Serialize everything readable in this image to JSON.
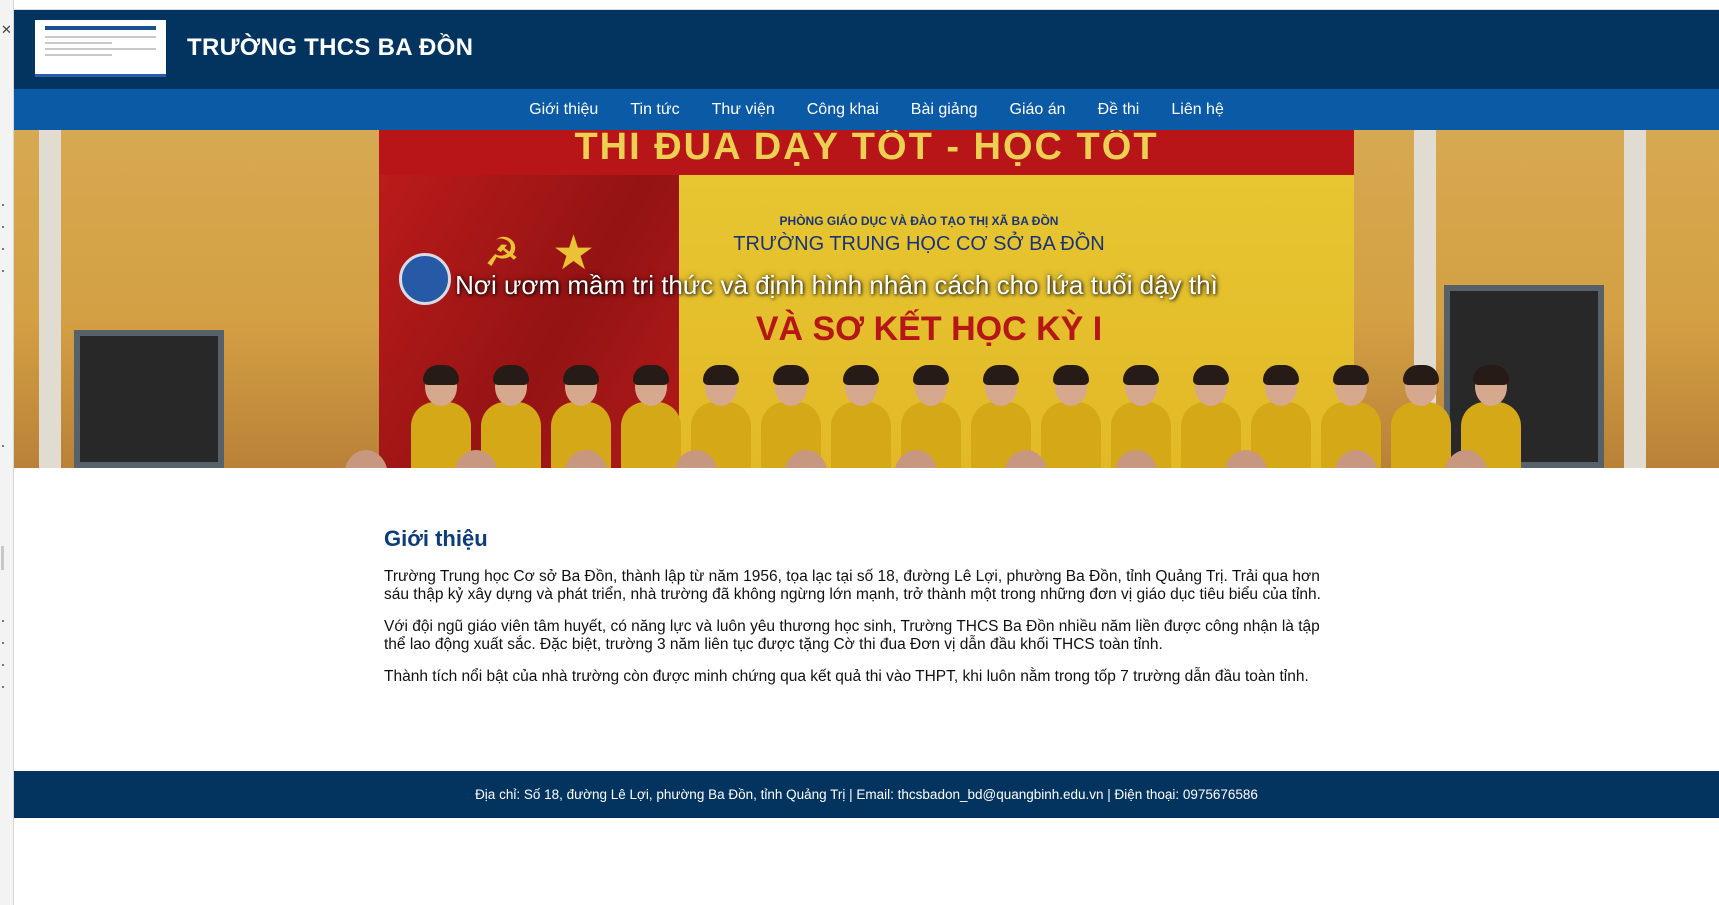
{
  "header": {
    "site_title": "TRƯỜNG THCS BA ĐỒN"
  },
  "nav": {
    "items": [
      "Giới thiệu",
      "Tin tức",
      "Thư viện",
      "Công khai",
      "Bài giảng",
      "Giáo án",
      "Đề thi",
      "Liên hệ"
    ]
  },
  "hero": {
    "caption": "Nơi ươm mầm tri thức và định hình nhân cách cho lứa tuổi dậy thì",
    "banner_top_text": "THI ĐUA DẠY TỐT - HỌC TỐT",
    "banner_small_text": "PHÒNG GIÁO DỤC VÀ ĐÀO TẠO THỊ XÃ BA ĐỒN",
    "banner_school_text": "TRƯỜNG TRUNG HỌC CƠ SỞ BA ĐỒN",
    "banner_big_text": "VÀ SƠ KẾT HỌC KỲ I"
  },
  "main": {
    "title": "Giới thiệu",
    "paragraphs": [
      "Trường Trung học Cơ sở Ba Đồn, thành lập từ năm 1956, tọa lạc tại số 18, đường Lê Lợi, phường Ba Đồn, tỉnh Quảng Trị. Trải qua hơn sáu thập kỷ xây dựng và phát triển, nhà trường đã không ngừng lớn mạnh, trở thành một trong những đơn vị giáo dục tiêu biểu của tỉnh.",
      "Với đội ngũ giáo viên tâm huyết, có năng lực và luôn yêu thương học sinh, Trường THCS Ba Đồn nhiều năm liền được công nhận là tập thể lao động xuất sắc. Đặc biệt, trường 3 năm liên tục được tặng Cờ thi đua Đơn vị dẫn đầu khối THCS toàn tỉnh.",
      "Thành tích nổi bật của nhà trường còn được minh chứng qua kết quả thi vào THPT, khi luôn nằm trong tốp 7 trường dẫn đầu toàn tỉnh."
    ]
  },
  "footer": {
    "text": "Địa chỉ: Số 18, đường Lê Lợi, phường Ba Đồn, tỉnh Quảng Trị | Email: thcsbadon_bd@quangbinh.edu.vn | Điện thoại: 0975676586"
  },
  "colors": {
    "header_bg": "#02345f",
    "nav_bg": "#0b5aa6",
    "title_color": "#0c3d7a",
    "footer_bg": "#02345f"
  },
  "icons": {
    "left_strip_close": "close-icon"
  }
}
